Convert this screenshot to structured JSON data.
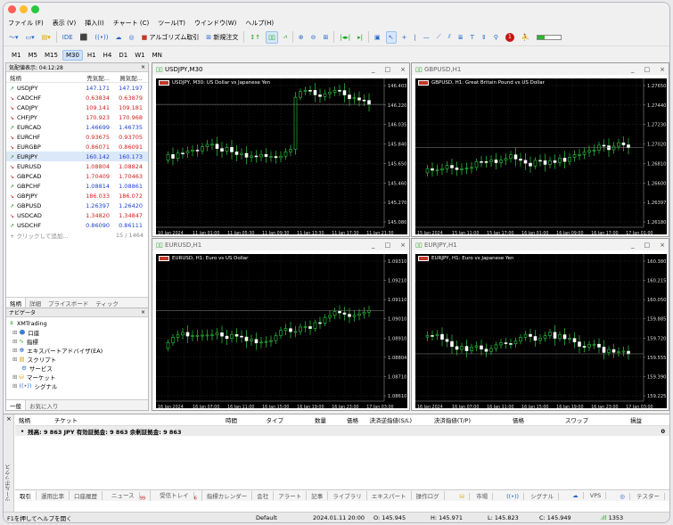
{
  "menu": [
    "ファイル (F)",
    "表示 (V)",
    "挿入(I)",
    "チャート (C)",
    "ツール(T)",
    "ウインドウ(W)",
    "ヘルプ(H)"
  ],
  "toolbar": {
    "ide": "IDE",
    "algo": "アルゴリズム取引",
    "new_order": "新規注文"
  },
  "timeframes": [
    "M1",
    "M5",
    "M15",
    "M30",
    "H1",
    "H4",
    "D1",
    "W1",
    "MN"
  ],
  "active_timeframe": "M30",
  "market_watch": {
    "title": "気配値表示: 04:12:28",
    "headers": {
      "symbol": "銘柄",
      "bid": "売気配...",
      "ask": "買気配..."
    },
    "rows": [
      {
        "dir": "up",
        "symbol": "USDJPY",
        "bid": "147.171",
        "ask": "147.197"
      },
      {
        "dir": "dn",
        "symbol": "CADCHF",
        "bid": "0.63834",
        "ask": "0.63879"
      },
      {
        "dir": "dn",
        "symbol": "CADJPY",
        "bid": "109.141",
        "ask": "109.181"
      },
      {
        "dir": "dn",
        "symbol": "CHFJPY",
        "bid": "170.923",
        "ask": "170.968"
      },
      {
        "dir": "up",
        "symbol": "EURCAD",
        "bid": "1.46699",
        "ask": "1.46735"
      },
      {
        "dir": "dn",
        "symbol": "EURCHF",
        "bid": "0.93675",
        "ask": "0.93705"
      },
      {
        "dir": "dn",
        "symbol": "EURGBP",
        "bid": "0.86071",
        "ask": "0.86091"
      },
      {
        "dir": "up",
        "symbol": "EURJPY",
        "bid": "160.142",
        "ask": "160.173"
      },
      {
        "dir": "dn",
        "symbol": "EURUSD",
        "bid": "1.08804",
        "ask": "1.08824"
      },
      {
        "dir": "dn",
        "symbol": "GBPCAD",
        "bid": "1.70409",
        "ask": "1.70463"
      },
      {
        "dir": "up",
        "symbol": "GBPCHF",
        "bid": "1.08814",
        "ask": "1.08861"
      },
      {
        "dir": "dn",
        "symbol": "GBPJPY",
        "bid": "186.033",
        "ask": "186.072"
      },
      {
        "dir": "up",
        "symbol": "GBPUSD",
        "bid": "1.26397",
        "ask": "1.26420"
      },
      {
        "dir": "dn",
        "symbol": "USDCAD",
        "bid": "1.34820",
        "ask": "1.34847"
      },
      {
        "dir": "up",
        "symbol": "USDCHF",
        "bid": "0.86090",
        "ask": "0.86111"
      }
    ],
    "add_label": "+ クリックして追加...",
    "count": "15 / 1464",
    "tabs": [
      "銘柄",
      "詳細",
      "プライスボード",
      "ティック"
    ]
  },
  "navigator": {
    "title": "ナビゲータ",
    "items": [
      "XMTrading",
      "口座",
      "指標",
      "エキスパートアドバイザ(EA)",
      "スクリプト",
      "サービス",
      "マーケット",
      "シグナル"
    ],
    "tabs": [
      "一般",
      "お気に入り"
    ]
  },
  "charts": [
    {
      "title": "USDJPY,M30",
      "label": "USDJPY, M30: US Dollar vs Japanese Yen",
      "prices": [
        "146.403",
        "146.220",
        "146.035",
        "145.840",
        "145.650",
        "145.460",
        "145.270",
        "145.080"
      ],
      "times": [
        "10 Jan 2024",
        "11 Jan 01:00",
        "11 Jan 05:30",
        "11 Jan 09:30",
        "11 Jan 13:30",
        "11 Jan 17:30",
        "11 Jan 21:30"
      ]
    },
    {
      "title": "GBPUSD,H1",
      "label": "GBPUSD, H1: Great Britain Pound vs US Dollar",
      "prices": [
        "1.27650",
        "1.27440",
        "1.27230",
        "1.27020",
        "1.26810",
        "1.26600",
        "1.26397",
        "1.26180"
      ],
      "times": [
        "15 Jan 2024",
        "15 Jan 11:00",
        "15 Jan 17:00",
        "16 Jan 01:00",
        "16 Jan 09:00",
        "16 Jan 17:00",
        "17 Jan 01:00"
      ]
    },
    {
      "title": "EURUSD,H1",
      "label": "EURUSD, H1: Euro vs US Dollar",
      "prices": [
        "1.09310",
        "1.09210",
        "1.09110",
        "1.09010",
        "1.08910",
        "1.08804",
        "1.08710",
        "1.08610"
      ],
      "times": [
        "16 Jan 2024",
        "16 Jan 07:00",
        "16 Jan 11:00",
        "16 Jan 15:00",
        "16 Jan 19:00",
        "16 Jan 23:00",
        "17 Jan 03:00"
      ]
    },
    {
      "title": "EURJPY,H1",
      "label": "EURJPY, H1: Euro vs Japanese Yen",
      "prices": [
        "160.380",
        "160.215",
        "160.050",
        "159.885",
        "159.720",
        "159.555",
        "159.390",
        "159.225"
      ],
      "times": [
        "16 Jan 2024",
        "16 Jan 07:00",
        "16 Jan 11:00",
        "16 Jan 15:00",
        "16 Jan 19:00",
        "16 Jan 23:00",
        "17 Jan 03:00"
      ]
    }
  ],
  "toolbox": {
    "headers": [
      "銘柄",
      "チケット",
      "時間",
      "タイプ",
      "数量",
      "価格",
      "決済逆指値(S/L)",
      "決済指値(T/P)",
      "価格",
      "スワップ",
      "損益"
    ],
    "balance": "残高: 9 863 JPY  有効証拠金: 9 863  余剰証拠金: 9 863",
    "balance_pl": "0",
    "tabs": [
      "取引",
      "運用比率",
      "口座履歴",
      "ニュース",
      "受信トレイ",
      "指標カレンダー",
      "会社",
      "アラート",
      "記事",
      "ライブラリ",
      "エキスパート",
      "操作ログ"
    ],
    "news_count": "99",
    "inbox_count": "6",
    "right": [
      "市場",
      "シグナル",
      "VPS",
      "テスター"
    ],
    "side_label": "ツールボックス"
  },
  "status": {
    "help": "F1を押してヘルプを開く",
    "profile": "Default",
    "time": "2024.01.11 20:00",
    "open": "O: 145.945",
    "high": "H: 145.971",
    "low": "L: 145.823",
    "close": "C: 145.949",
    "ping": "1353"
  }
}
